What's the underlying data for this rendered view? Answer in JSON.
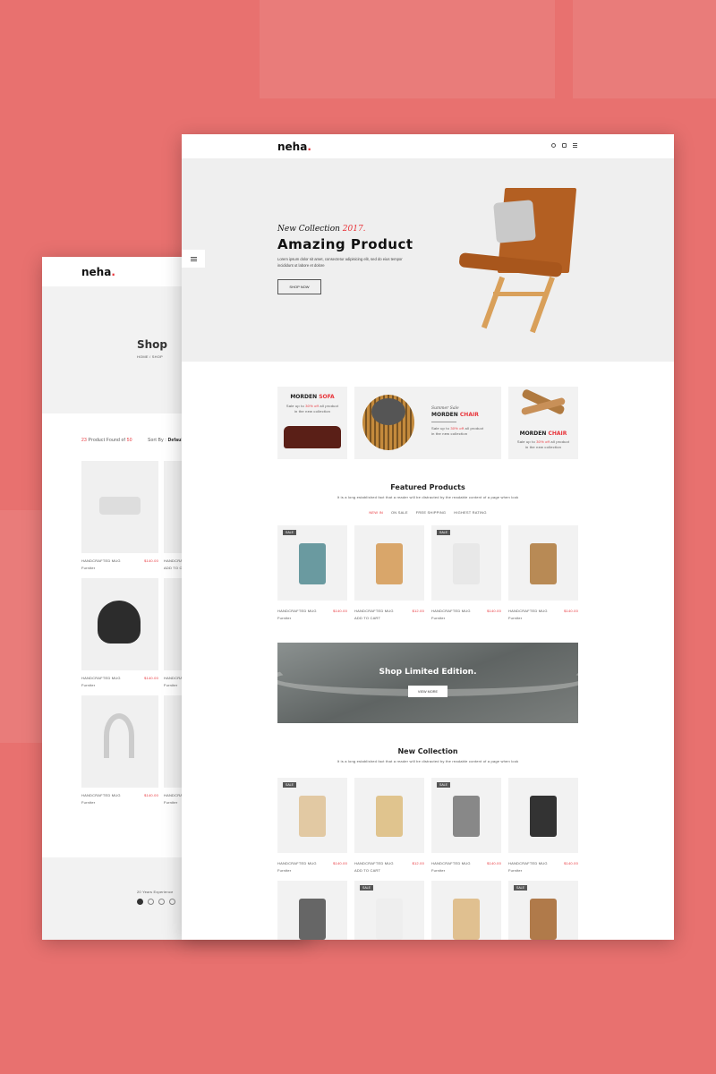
{
  "brand": {
    "name": "neha",
    "dot": ".",
    "accent": "#e8343a",
    "background": "#e8716f"
  },
  "shop_page": {
    "title": "Shop",
    "breadcrumb": "HOME / SHOP",
    "found_count": "23",
    "found_text": " Product Found of ",
    "found_total": "50",
    "sort_label": "Sort By : ",
    "sort_value": "Default",
    "products": [
      {
        "name": "HANDCRAFTED MUG",
        "price": "$140.00",
        "category": "Furniter",
        "image": "drone"
      },
      {
        "name": "HANDCRAFTED MUG",
        "price": "",
        "category": "ADD TO CART",
        "image": ""
      },
      {
        "name": "HANDCRAFTED MUG",
        "price": "$140.00",
        "category": "Furniter",
        "image": "clock"
      },
      {
        "name": "HANDCRAFTED MUG",
        "price": "",
        "category": "Furniter",
        "image": ""
      },
      {
        "name": "HANDCRAFTED MUG",
        "price": "$140.00",
        "category": "Furniter",
        "image": "headphones"
      },
      {
        "name": "HANDCRAFTED MUG",
        "price": "",
        "category": "Furniter",
        "image": ""
      }
    ],
    "footer": {
      "text": "20 Years Experience",
      "socials": [
        "twitter-icon",
        "google-icon",
        "facebook-icon",
        "instagram-icon"
      ]
    }
  },
  "home_page": {
    "header_icons": [
      "search-icon",
      "cart-icon",
      "menu-icon"
    ],
    "hero": {
      "script": "New Collection ",
      "year": "2017.",
      "title": "Amazing Product",
      "text": "Lorem ipsum dolor sit amet, consectetur adipisicing elit, sed do eius tempor incididunt ut labore et dolore",
      "button": "SHOP NOW"
    },
    "promos": [
      {
        "title": "MORDEN ",
        "accent": "SOFA",
        "text1": "Sale up to ",
        "off": "30% off",
        "text2": " all product",
        "text3": "in the new collection"
      },
      {
        "kicker": "Summer Sale",
        "title": "MORDEN ",
        "accent": "CHAIR",
        "text1": "Sale up to ",
        "off": "30% off",
        "text2": " all product",
        "text3": "in the new collection"
      },
      {
        "title": "MORDEN ",
        "accent": "CHAIR",
        "text1": "Sale up to ",
        "off": "30% off",
        "text2": " all product",
        "text3": "in the new collection"
      }
    ],
    "featured": {
      "title": "Featured Products",
      "subtitle": "It is a long established fact that a reader will be distracted by the readable content of a page when look",
      "tabs": [
        "NEW IN",
        "ON SALE",
        "FREE SHIPPING",
        "HIGHEST RATING"
      ],
      "active_tab": "NEW IN",
      "products": [
        {
          "name": "HANDCRAFTED MUG",
          "price": "$140.00",
          "sub": "Furniter",
          "badge": "SALE"
        },
        {
          "name": "HANDCRAFTED MUG",
          "price": "$12.00",
          "sub": "ADD TO CART",
          "badge": ""
        },
        {
          "name": "HANDCRAFTED MUG",
          "price": "$140.00",
          "sub": "Furniter",
          "badge": "SALE"
        },
        {
          "name": "HANDCRAFTED MUG",
          "price": "$140.00",
          "sub": "Furniter",
          "badge": ""
        }
      ]
    },
    "limited": {
      "title": "Shop Limited Edition.",
      "button": "VIEW MORE"
    },
    "new_collection": {
      "title": "New Collection",
      "subtitle": "It is a long established fact that a reader will be distracted by the readable content of a page when look",
      "products": [
        {
          "name": "HANDCRAFTED MUG",
          "price": "$140.00",
          "sub": "Furniter",
          "badge": "SALE"
        },
        {
          "name": "HANDCRAFTED MUG",
          "price": "$12.00",
          "sub": "ADD TO CART",
          "badge": ""
        },
        {
          "name": "HANDCRAFTED MUG",
          "price": "$140.00",
          "sub": "Furniter",
          "badge": "SALE"
        },
        {
          "name": "HANDCRAFTED MUG",
          "price": "$140.00",
          "sub": "Furniter",
          "badge": ""
        },
        {
          "badge": ""
        },
        {
          "badge": "SALE"
        },
        {
          "badge": ""
        },
        {
          "badge": "SALE"
        }
      ]
    }
  }
}
